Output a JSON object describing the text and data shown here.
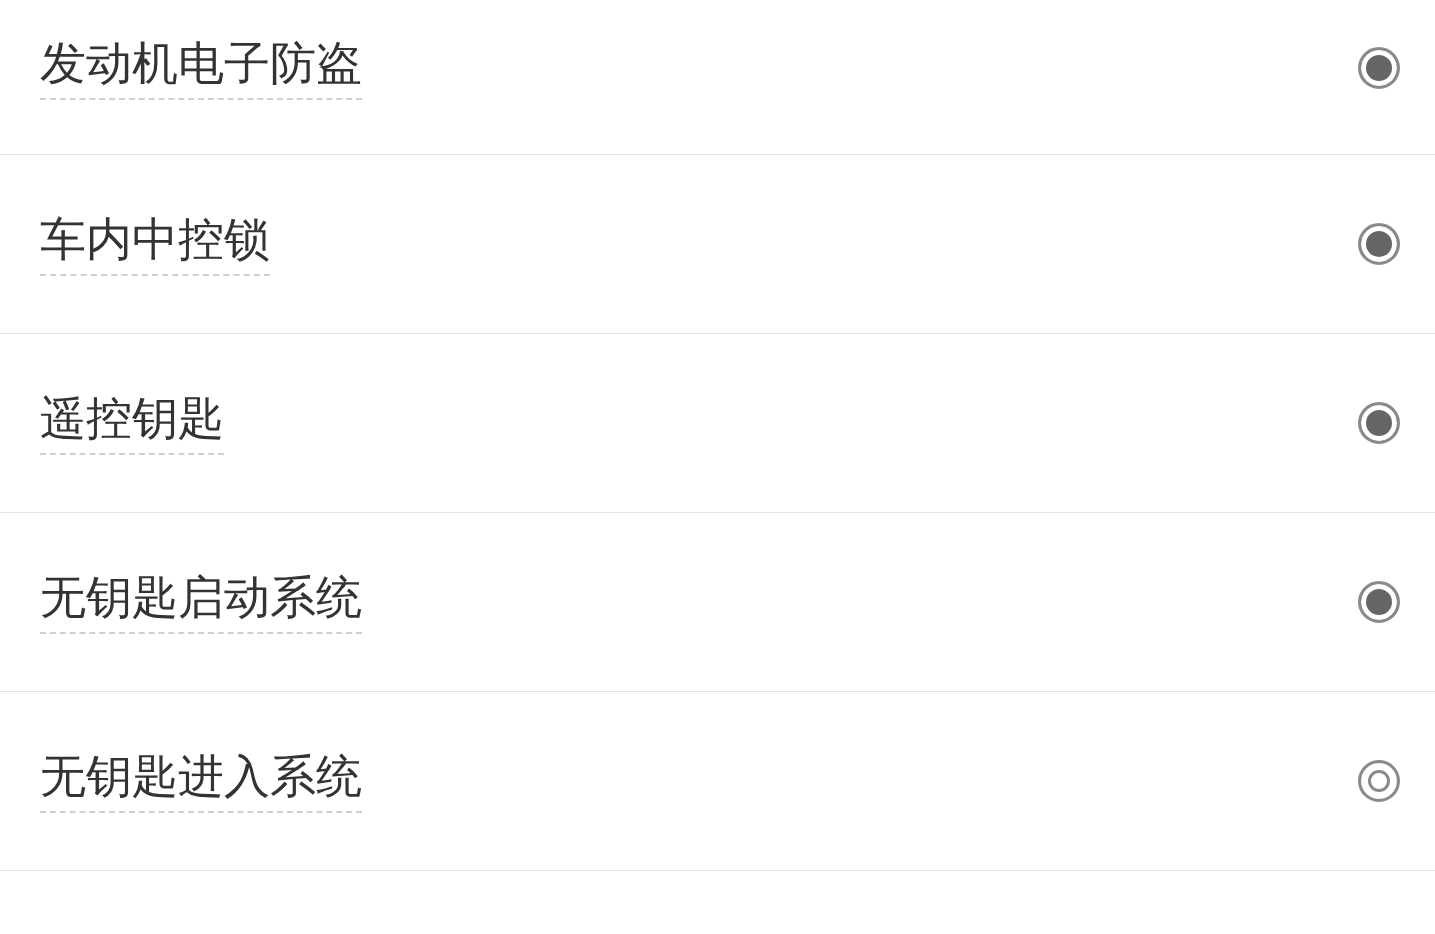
{
  "items": [
    {
      "label": "发动机电子防盗",
      "checked": true
    },
    {
      "label": "车内中控锁",
      "checked": true
    },
    {
      "label": "遥控钥匙",
      "checked": true
    },
    {
      "label": "无钥匙启动系统",
      "checked": true
    },
    {
      "label": "无钥匙进入系统",
      "checked": false
    }
  ]
}
